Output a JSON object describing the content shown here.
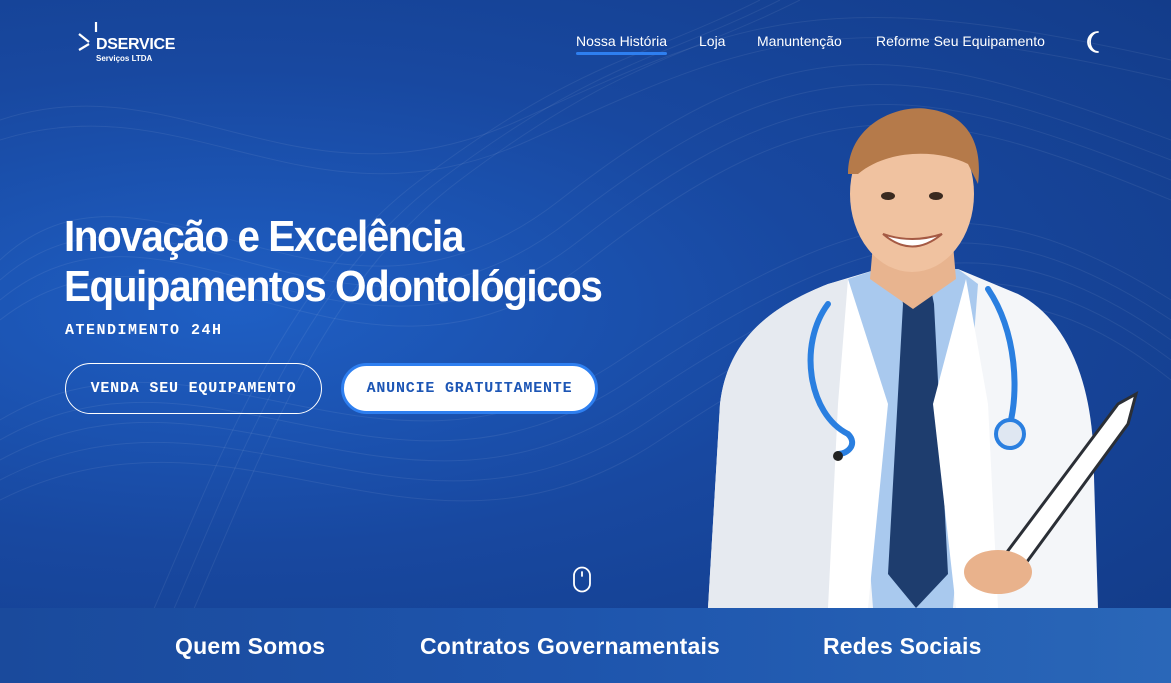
{
  "brand": {
    "name": "DSERVICE",
    "subtitle": "Serviços LTDA"
  },
  "nav": {
    "items": [
      {
        "label": "Nossa História",
        "active": true
      },
      {
        "label": "Loja",
        "active": false
      },
      {
        "label": "Manuntenção",
        "active": false
      },
      {
        "label": "Reforme Seu Equipamento",
        "active": false
      }
    ],
    "theme_icon": "moon-icon"
  },
  "hero": {
    "headline_line1": "Inovação e Excelência",
    "headline_line2": "Equipamentos Odontológicos",
    "tagline": "ATENDIMENTO 24H",
    "button_primary": "VENDA SEU EQUIPAMENTO",
    "button_secondary": "ANUNCIE GRATUITAMENTE",
    "scroll_icon": "mouse-scroll-icon"
  },
  "sections": [
    {
      "label": "Quem Somos"
    },
    {
      "label": "Contratos Governamentais"
    },
    {
      "label": "Redes Sociais"
    }
  ],
  "colors": {
    "hero_background": "#1d4fa6",
    "accent": "#2e7ff0",
    "text": "#ffffff"
  }
}
